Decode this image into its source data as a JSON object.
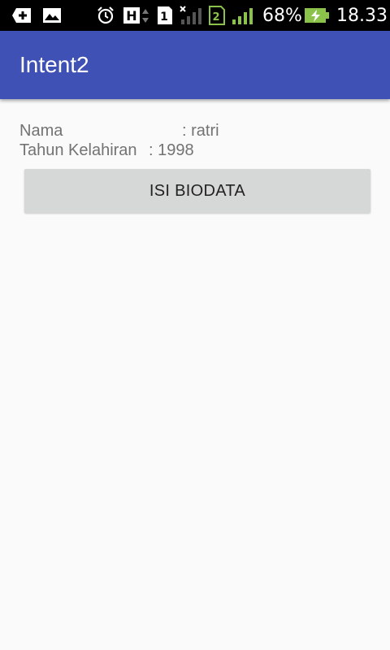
{
  "status_bar": {
    "battery_percent_text": "68%",
    "time": "18.33",
    "sim1_label": "1",
    "sim2_label": "2",
    "network_type": "H",
    "icons": [
      "plus-icon",
      "image-icon",
      "alarm-icon",
      "h-network-icon",
      "sim1-icon",
      "signal-muted-icon",
      "sim2-icon",
      "signal-icon",
      "battery-charging-icon"
    ],
    "accent_green": "#8bc34a"
  },
  "app_bar": {
    "title": "Intent2",
    "color": "#3f51b5"
  },
  "content": {
    "nama_label": "Nama",
    "nama_value": ": ratri",
    "tahun_label": "Tahun Kelahiran",
    "tahun_value": ": 1998",
    "button_label": "ISI BIODATA"
  }
}
